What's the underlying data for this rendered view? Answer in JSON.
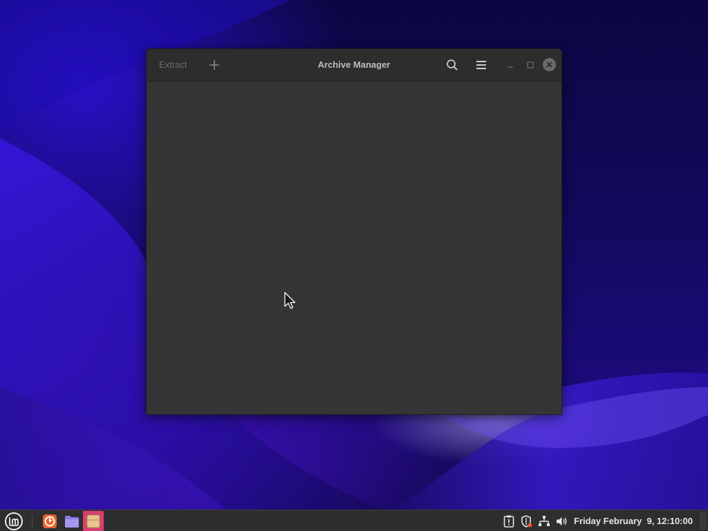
{
  "desktop": {
    "wallpaper": "linux-mint-purple-waves"
  },
  "window": {
    "title": "Archive Manager",
    "headerbar": {
      "extract_label": "Extract",
      "extract_enabled": false,
      "add_icon": "plus-icon",
      "search_icon": "search-icon",
      "menu_icon": "hamburger-menu-icon",
      "minimize_icon": "minimize-icon",
      "maximize_icon": "maximize-icon",
      "close_icon": "close-icon"
    },
    "content": {
      "empty": true
    }
  },
  "taskbar": {
    "menu_icon": "linux-mint-logo-icon",
    "launchers": [
      {
        "name": "Firefox",
        "icon": "firefox-icon"
      },
      {
        "name": "Files",
        "icon": "folder-icon"
      },
      {
        "name": "Archive Manager",
        "icon": "archive-icon",
        "active": true
      }
    ],
    "tray": [
      {
        "icon": "update-manager-icon"
      },
      {
        "icon": "shield-icon"
      },
      {
        "icon": "network-icon"
      },
      {
        "icon": "volume-icon"
      }
    ],
    "clock": "Friday February  9, 12:10:00"
  },
  "colors": {
    "window_bg": "#353535",
    "headerbar_bg": "#2d2d2d",
    "taskbar_bg": "#2e2e2e",
    "active_app_highlight": "#d8406f",
    "wallpaper_primary": "#2a10c8"
  }
}
